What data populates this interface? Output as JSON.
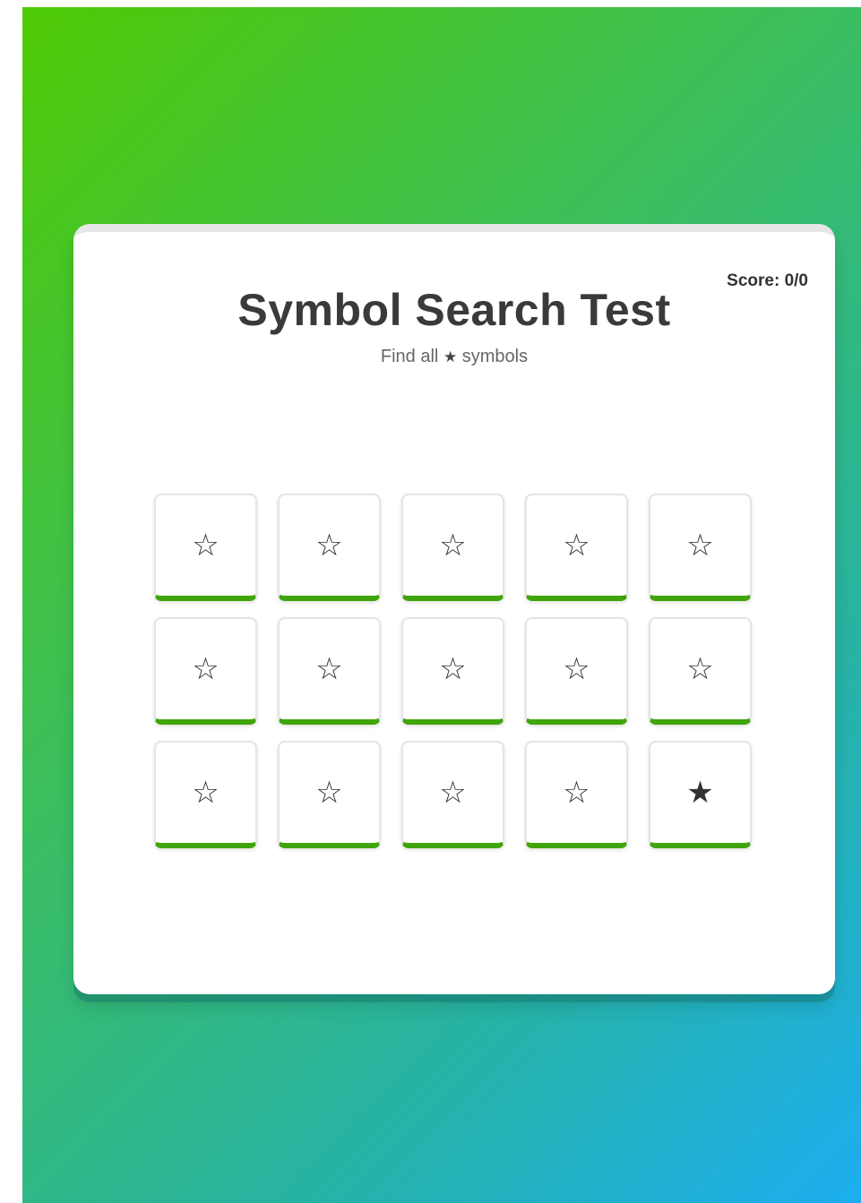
{
  "game": {
    "score_label": "Score: 0/0",
    "title": "Symbol Search Test",
    "instruction_prefix": "Find all",
    "target_symbol": "★",
    "instruction_suffix": "symbols",
    "grid": {
      "rows": 3,
      "columns": 5,
      "cells": [
        "☆",
        "☆",
        "☆",
        "☆",
        "☆",
        "☆",
        "☆",
        "☆",
        "☆",
        "☆",
        "☆",
        "☆",
        "☆",
        "☆",
        "★"
      ]
    }
  },
  "colors": {
    "gradient_start": "#4fca04",
    "gradient_end": "#1caef0",
    "cell_accent": "#3fa50a",
    "text_dark": "#3a3a3a"
  }
}
